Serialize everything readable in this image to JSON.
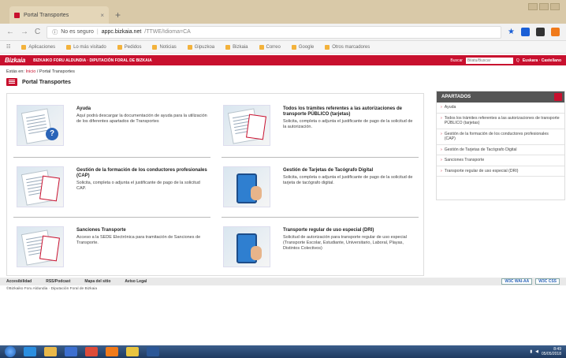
{
  "browser": {
    "tab_title": "Portal Transportes",
    "new_tab": "+",
    "address_prefix": "No es seguro",
    "address_separator": "|",
    "address_host": "appc.bizkaia.net",
    "address_path": "/TTWE/Idioma=CA",
    "back_glyph": "←",
    "forward_glyph": "→",
    "reload_glyph": "C",
    "info_glyph": "ⓘ",
    "star_glyph": "★",
    "tab_close_glyph": "×"
  },
  "bookmarks": {
    "apps_glyph": "☷",
    "items": [
      "Aplicaciones",
      "Lo más visitado",
      "Pedidos",
      "Noticias",
      "Gipuzkoa",
      "Bizkaia",
      "Correo",
      "Google",
      "Otros marcadores"
    ]
  },
  "site_header": {
    "logo": "Bizkaia",
    "site_name": "Bizkaiko Foru Aldundia · Diputación Foral de Bizkaia",
    "search_label": "Buscar",
    "search_placeholder": "Bilatu/Buscar",
    "search_icon": "Q",
    "link": "Euskara · Castellano"
  },
  "breadcrumb": {
    "label": "Estás en:",
    "home": "Inicio",
    "separator": "/",
    "current": "Portal Transportes"
  },
  "page_title": "Portal Transportes",
  "cards": [
    {
      "title": "Ayuda",
      "text": "Aquí podrá descargar la documentación de ayuda para la utilización de los diferentes apartados de Transportes",
      "badge": "?"
    },
    {
      "title": "Todos los trámites referentes a las autorizaciones de transporte PÚBLICO (tarjetas)",
      "text": "Solicita, completa o adjunta el justificante de pago de la solicitud de la autorización."
    },
    {
      "title": "Gestión de la formación de los conductores profesionales (CAP)",
      "text": "Solicita, completa o adjunta el justificante de pago de la solicitud CAP."
    },
    {
      "title": "Gestión de Tarjetas de Tacógrafo Digital",
      "text": "Solicita, completa o adjunta el justificante de pago de la solicitud de tarjeta de tacógrafo digital."
    },
    {
      "title": "Sanciones Transporte",
      "text": "Acceso a la SEDE Electrónica para tramitación de Sanciones de Transporte."
    },
    {
      "title": "Transporte regular de uso especial (DRI)",
      "text": "Solicitud de autorización para transporte regular de uso especial (Transporte Escolar, Estudiante, Universitario, Laboral, Playas, Distintos Colectivos)"
    }
  ],
  "sidebar": {
    "title": "APARTADOS",
    "arrow": "›",
    "items": [
      "Ayuda",
      "Todos los trámites referentes a las autorizaciones de transporte PÚBLICO (tarjetas)",
      "Gestión de la formación de los conductores profesionales (CAP)",
      "Gestión de Tarjetas de Tacógrafo Digital",
      "Sanciones Transporte",
      "Transporte regular de uso especial (DRI)"
    ]
  },
  "footer": {
    "links": [
      "Accesibilidad",
      "RSS/Podcast",
      "Mapa del sitio",
      "Aviso Legal"
    ],
    "badges": [
      "W3C WAI-AA",
      "W3C CSS"
    ],
    "copyright": "©Bizkaiko Foru Aldundia · Diputación Foral de Bizkaia"
  },
  "taskbar": {
    "clock_time": "8:49",
    "clock_date": "05/05/2018"
  },
  "colors": {
    "brand_red": "#c8102e",
    "sidebar_head": "#555555"
  }
}
